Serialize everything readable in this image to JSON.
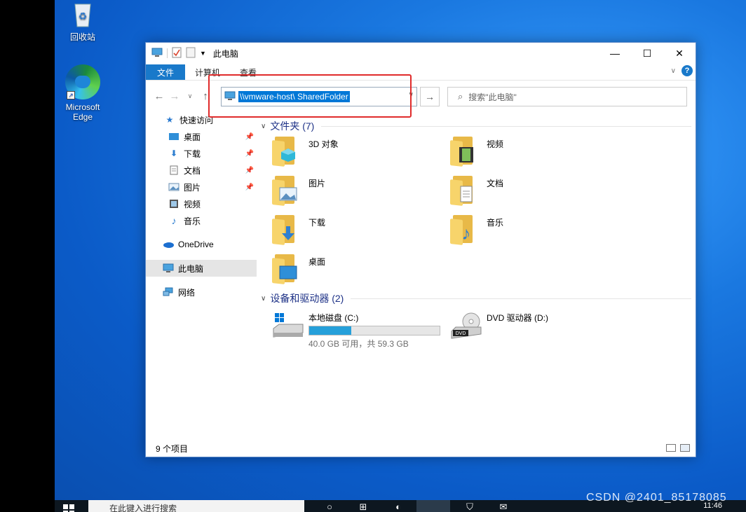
{
  "desktop": {
    "recycle_bin": "回收站",
    "edge": "Microsoft Edge"
  },
  "window": {
    "title": "此电脑",
    "controls": {
      "minimize": "—",
      "maximize": "☐",
      "close": "✕"
    }
  },
  "ribbon": {
    "tabs": [
      "文件",
      "计算机",
      "查看"
    ],
    "help": "?"
  },
  "navbar": {
    "address": "\\\\vmware-host\\ SharedFolder",
    "search_placeholder": "搜索\"此电脑\""
  },
  "sidebar": {
    "quick_access": "快速访问",
    "items": [
      {
        "label": "桌面",
        "icon": "desktop-icon",
        "pinned": true
      },
      {
        "label": "下载",
        "icon": "download-icon",
        "pinned": true
      },
      {
        "label": "文档",
        "icon": "document-icon",
        "pinned": true
      },
      {
        "label": "图片",
        "icon": "picture-icon",
        "pinned": true
      },
      {
        "label": "视频",
        "icon": "video-icon",
        "pinned": false
      },
      {
        "label": "音乐",
        "icon": "music-icon",
        "pinned": false
      }
    ],
    "onedrive": "OneDrive",
    "this_pc": "此电脑",
    "network": "网络"
  },
  "main": {
    "folders_header": "文件夹 (7)",
    "folders": [
      {
        "label": "3D 对象",
        "icon": "3d-objects-icon"
      },
      {
        "label": "视频",
        "icon": "video-icon"
      },
      {
        "label": "图片",
        "icon": "picture-icon"
      },
      {
        "label": "文档",
        "icon": "document-icon"
      },
      {
        "label": "下载",
        "icon": "download-icon"
      },
      {
        "label": "音乐",
        "icon": "music-icon"
      },
      {
        "label": "桌面",
        "icon": "desktop-icon"
      }
    ],
    "drives_header": "设备和驱动器 (2)",
    "drives": [
      {
        "name": "本地磁盘 (C:)",
        "free_text": "40.0 GB 可用，共 59.3 GB",
        "used_fraction": 0.325
      },
      {
        "name": "DVD 驱动器 (D:)"
      }
    ]
  },
  "status": {
    "count": "9 个项目"
  },
  "taskbar": {
    "search_text": "在此键入进行搜索",
    "clock": "11:46"
  },
  "watermark": "CSDN @2401_85178085",
  "colors": {
    "accent": "#1979ca",
    "highlight": "#e02b2b",
    "selection": "#0078d7"
  }
}
